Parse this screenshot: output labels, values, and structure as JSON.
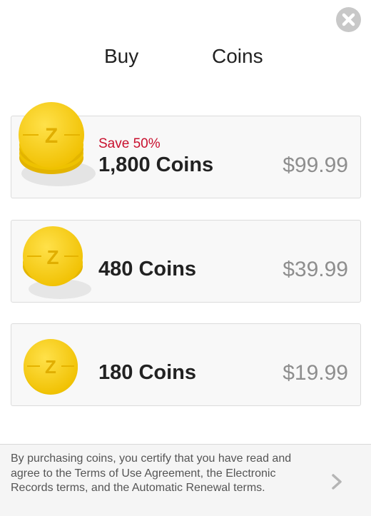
{
  "header": {
    "title_left": "Buy",
    "title_right": "Coins",
    "close_icon": "close-icon"
  },
  "offers": [
    {
      "badge": "Save 50%",
      "coins": "1,800 Coins",
      "price": "$99.99",
      "coin_letter": "Z",
      "coin_icon": "coin-stack-large-icon"
    },
    {
      "coins": "480 Coins",
      "price": "$39.99",
      "coin_letter": "Z",
      "coin_icon": "coin-stack-small-icon"
    },
    {
      "coins": "180 Coins",
      "price": "$19.99",
      "coin_letter": "Z",
      "coin_icon": "coin-icon"
    }
  ],
  "footer": {
    "terms": "By purchasing coins, you certify that you have read and agree to the Terms of Use Agreement, the Electronic Records terms, and the Automatic Renewal terms.",
    "chevron_icon": "chevron-right-icon"
  },
  "colors": {
    "coin_gold": "#f5cc1a",
    "coin_edge": "#e3b400",
    "save_red": "#c8102e",
    "price_gray": "#8e8e8e",
    "card_bg": "#f8f8f8",
    "footer_bg": "#f5f5f5"
  }
}
